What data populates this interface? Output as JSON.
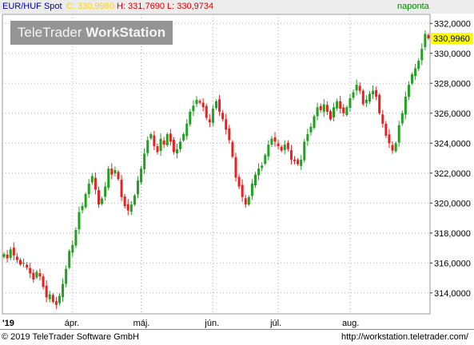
{
  "header": {
    "instrument": "EUR/HUF Spot",
    "close_label": "C: 330,9960",
    "hl_label": "H: 331,7690 L: 330,9734",
    "period": "naponta"
  },
  "watermark": {
    "part1": "TeleTrader",
    "part2": "WorkStation"
  },
  "footer": {
    "copyright": "© 2019 TeleTrader Software GmbH",
    "url": "http://workstation.teletrader.com/"
  },
  "colors": {
    "up": "#22a022",
    "down": "#e82020",
    "header_bg": "#ececec",
    "close_label": "#ffd200",
    "hl_label": "#e00000",
    "period": "#008800",
    "price_tag": "#ffff00",
    "grid": "#b0b0b0"
  },
  "chart_data": {
    "type": "candlestick",
    "ylim": [
      312.6,
      332.6
    ],
    "y_ticks": [
      "332,0000",
      "330,0000",
      "328,0000",
      "326,0000",
      "324,0000",
      "322,0000",
      "320,0000",
      "318,0000",
      "316,0000",
      "314,0000"
    ],
    "y_tick_values": [
      332,
      330,
      328,
      326,
      324,
      322,
      320,
      318,
      316,
      314
    ],
    "x_labels": [
      {
        "label": "'19",
        "index": 0
      },
      {
        "label": "ápr.",
        "index": 21
      },
      {
        "label": "máj.",
        "index": 42
      },
      {
        "label": "jún.",
        "index": 64
      },
      {
        "label": "júl.",
        "index": 84
      },
      {
        "label": "aug.",
        "index": 106
      }
    ],
    "last_price_label": "330,9960",
    "last_price": 331.0,
    "grid": true,
    "closes": [
      316.6,
      316.3,
      316.9,
      316.5,
      316.2,
      315.9,
      316.0,
      315.7,
      315.3,
      314.9,
      315.4,
      315.1,
      314.4,
      313.7,
      313.9,
      313.4,
      313.2,
      313.8,
      314.6,
      315.6,
      316.8,
      317.2,
      318.2,
      319.4,
      319.8,
      320.6,
      321.3,
      321.8,
      320.9,
      319.9,
      320.3,
      321.1,
      322.3,
      321.9,
      322.2,
      321.6,
      320.4,
      319.8,
      319.5,
      319.9,
      320.5,
      321.5,
      322.3,
      323.3,
      324.2,
      324.6,
      323.8,
      323.4,
      324.3,
      323.9,
      324.6,
      324.1,
      323.4,
      323.6,
      324.1,
      324.6,
      325.3,
      326.1,
      326.5,
      326.9,
      326.7,
      326.4,
      325.7,
      325.4,
      326.3,
      326.8,
      326.1,
      325.6,
      324.9,
      324.2,
      323.1,
      321.7,
      321.1,
      320.4,
      319.9,
      320.4,
      321.3,
      321.9,
      322.3,
      322.5,
      323.2,
      323.9,
      324.3,
      324.1,
      323.8,
      323.5,
      323.9,
      323.6,
      322.9,
      322.8,
      322.6,
      322.9,
      324.1,
      324.6,
      325.1,
      325.8,
      326.4,
      326.2,
      326.6,
      326.1,
      325.6,
      326.4,
      326.8,
      326.3,
      326.0,
      326.4,
      327.0,
      327.4,
      327.9,
      327.5,
      326.6,
      326.9,
      327.3,
      327.5,
      327.1,
      326.0,
      325.3,
      324.5,
      324.0,
      323.5,
      324.0,
      325.2,
      326.0,
      327.1,
      327.9,
      328.6,
      329.0,
      329.5,
      330.3,
      331.3,
      331.0
    ]
  }
}
